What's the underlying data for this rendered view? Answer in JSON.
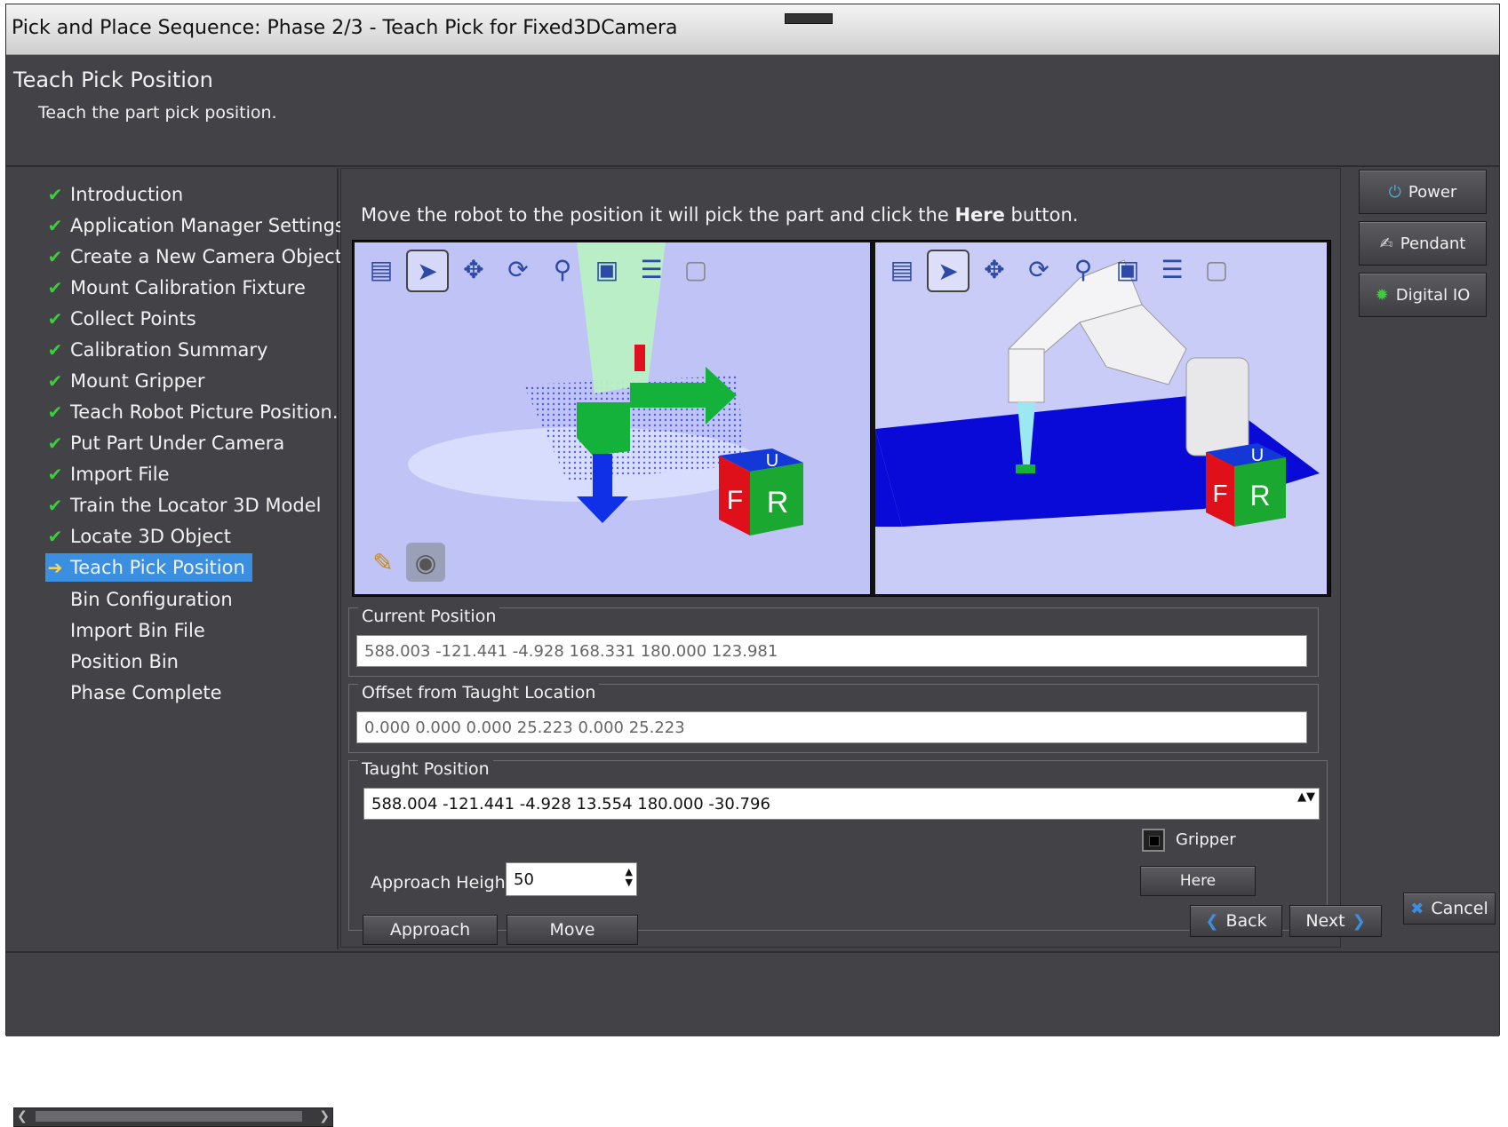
{
  "window": {
    "title": "Pick and Place Sequence: Phase 2/3 - Teach Pick for Fixed3DCamera"
  },
  "header": {
    "title": "Teach Pick Position",
    "subtitle": "Teach the part pick position."
  },
  "steps": [
    {
      "label": "Introduction",
      "state": "done"
    },
    {
      "label": "Application Manager Settings",
      "state": "done"
    },
    {
      "label": "Create a New Camera Object",
      "state": "done"
    },
    {
      "label": "Mount Calibration Fixture",
      "state": "done"
    },
    {
      "label": "Collect Points",
      "state": "done"
    },
    {
      "label": "Calibration Summary",
      "state": "done"
    },
    {
      "label": "Mount Gripper",
      "state": "done"
    },
    {
      "label": "Teach Robot Picture Position.",
      "state": "done"
    },
    {
      "label": "Put Part Under Camera",
      "state": "done"
    },
    {
      "label": "Import File",
      "state": "done"
    },
    {
      "label": "Train the Locator 3D Model",
      "state": "done"
    },
    {
      "label": "Locate 3D Object",
      "state": "done"
    },
    {
      "label": "Teach Pick Position",
      "state": "current"
    },
    {
      "label": "Bin Configuration",
      "state": "todo"
    },
    {
      "label": "Import Bin File",
      "state": "todo"
    },
    {
      "label": "Position Bin",
      "state": "todo"
    },
    {
      "label": "Phase Complete",
      "state": "todo"
    }
  ],
  "instruction": {
    "before": "Move the robot to the position it will pick the part and click the ",
    "bold": "Here",
    "after": " button."
  },
  "view_cube": {
    "front": "F",
    "right": "R",
    "top": "U"
  },
  "current_position": {
    "label": "Current Position",
    "value": "588.003 -121.441 -4.928 168.331 180.000 123.981"
  },
  "offset": {
    "label": "Offset from Taught Location",
    "value": "0.000 0.000 0.000 25.223 0.000 25.223"
  },
  "taught": {
    "label": "Taught Position",
    "value": "588.004 -121.441 -4.928 13.554 180.000 -30.796",
    "approach_label": "Approach Height",
    "approach_value": "50",
    "gripper_label": "Gripper",
    "here_label": "Here",
    "approach_button": "Approach",
    "move_button": "Move"
  },
  "side_buttons": {
    "power": "Power",
    "pendant": "Pendant",
    "digital_io": "Digital IO"
  },
  "nav_buttons": {
    "back": "Back",
    "next": "Next",
    "cancel": "Cancel"
  },
  "colors": {
    "background": "#434347",
    "selected": "#3b8fe0",
    "check": "#3ccd3c",
    "point_cloud": "#1010e0",
    "cube_red": "#e0101a",
    "cube_green": "#1aa830",
    "cube_blue": "#1438d8"
  }
}
